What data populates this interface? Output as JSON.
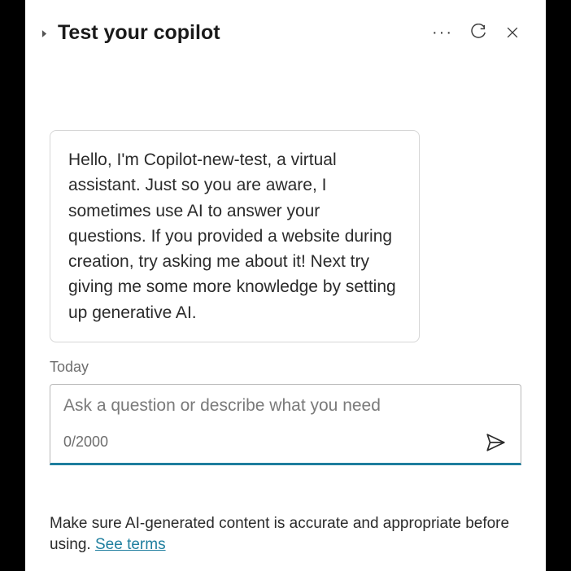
{
  "header": {
    "title": "Test your copilot"
  },
  "message": {
    "text": "Hello, I'm Copilot-new-test, a virtual assistant. Just so you are aware, I sometimes use AI to answer your questions. If you provided a website during creation, try asking me about it! Next try giving me some more knowledge by setting up generative AI."
  },
  "day_label": "Today",
  "input": {
    "placeholder": "Ask a question or describe what you need",
    "counter": "0/2000"
  },
  "footer": {
    "notice": "Make sure AI-generated content is accurate and appropriate before using. ",
    "link_label": "See terms"
  }
}
